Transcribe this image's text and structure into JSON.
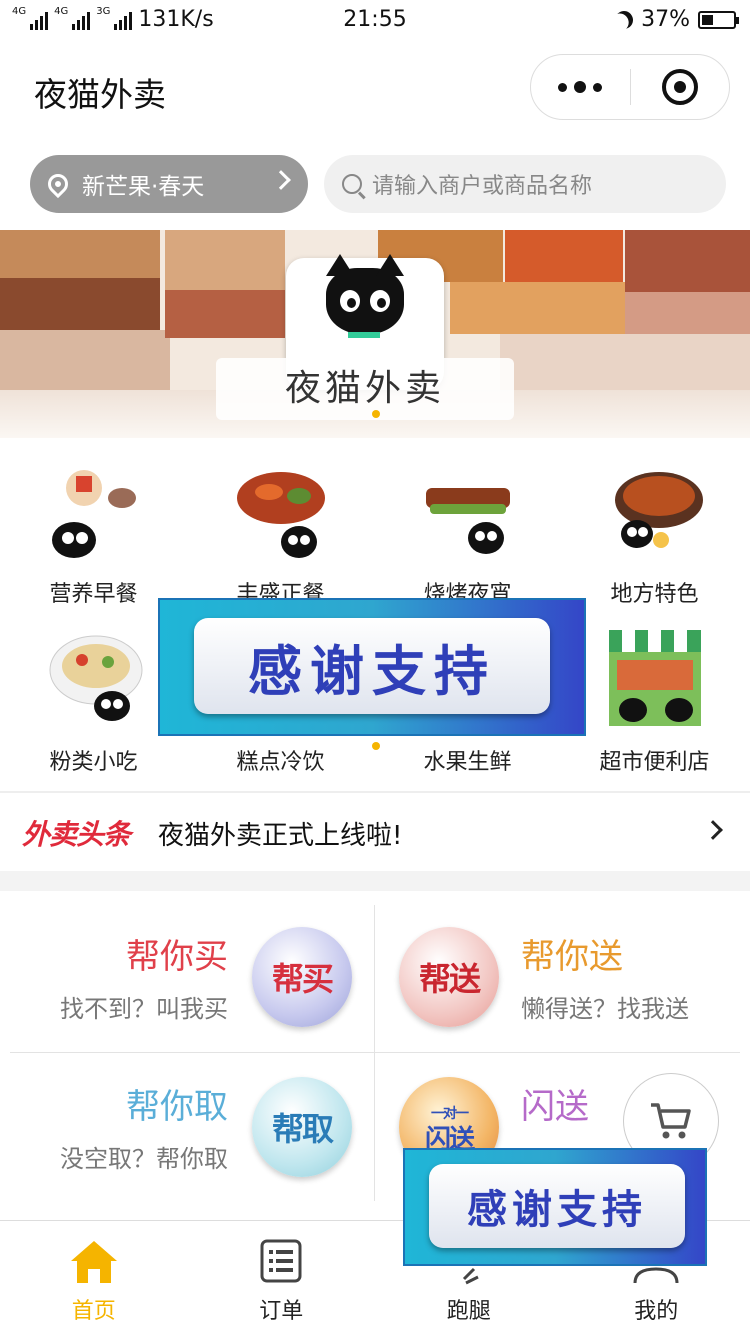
{
  "status_bar": {
    "net1": "4G",
    "net2": "4G",
    "net3": "3G",
    "speed": "131K/s",
    "time": "21:55",
    "battery": "37%",
    "battery_level": 0.37
  },
  "nav": {
    "title": "夜猫外卖"
  },
  "location": {
    "label": "新芒果·春天"
  },
  "search": {
    "placeholder": "请输入商户或商品名称"
  },
  "banner": {
    "brand_text": "夜猫外卖"
  },
  "categories": [
    {
      "label": "营养早餐",
      "icon": "breakfast-icon"
    },
    {
      "label": "丰盛正餐",
      "icon": "meal-icon"
    },
    {
      "label": "烧烤夜宵",
      "icon": "bbq-icon"
    },
    {
      "label": "地方特色",
      "icon": "local-food-icon"
    },
    {
      "label": "粉类小吃",
      "icon": "noodle-icon"
    },
    {
      "label": "糕点冷饮",
      "icon": "dessert-icon"
    },
    {
      "label": "水果生鲜",
      "icon": "fruit-icon"
    },
    {
      "label": "超市便利店",
      "icon": "market-icon"
    }
  ],
  "overlay_text": "感谢支持",
  "news": {
    "tag": "外卖头条",
    "text": "夜猫外卖正式上线啦!"
  },
  "services": [
    {
      "title": "帮你买",
      "subtitle": "找不到？叫我买",
      "badge": "帮买",
      "color": "#e0404a"
    },
    {
      "title": "帮你送",
      "subtitle": "懒得送？找我送",
      "badge": "帮送",
      "color": "#e89a2e"
    },
    {
      "title": "帮你取",
      "subtitle": "没空取？帮你取",
      "badge": "帮取",
      "color": "#5aaed8"
    },
    {
      "title": "闪送",
      "subtitle": "",
      "badge_top": "一对一",
      "badge": "闪送",
      "color": "#b56ac9"
    }
  ],
  "tabs": [
    {
      "label": "首页",
      "icon": "home-icon"
    },
    {
      "label": "订单",
      "icon": "order-list-icon"
    },
    {
      "label": "跑腿",
      "icon": "errand-icon"
    },
    {
      "label": "我的",
      "icon": "profile-icon"
    }
  ],
  "colors": {
    "accent": "#f5b400",
    "headline_red": "#e02a3b"
  }
}
